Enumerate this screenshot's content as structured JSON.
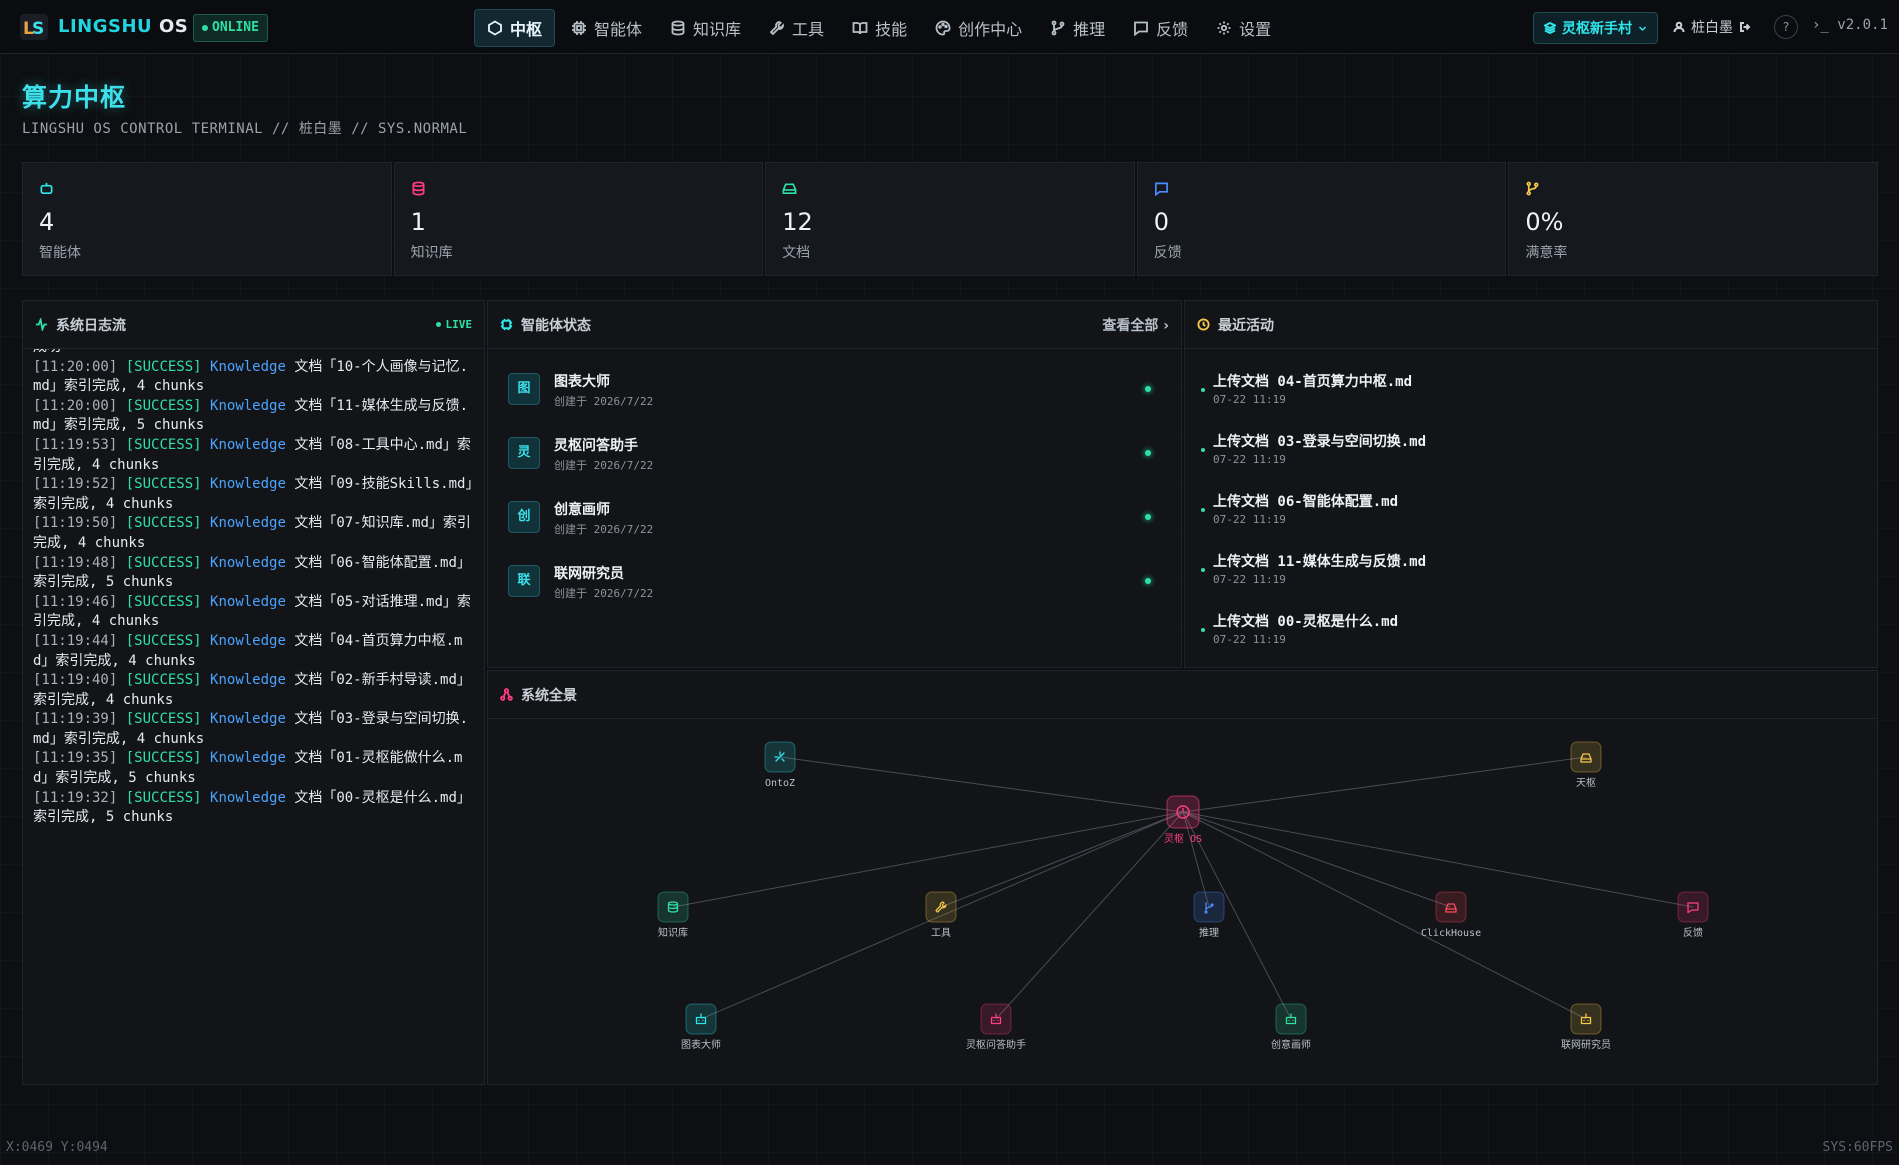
{
  "header": {
    "brand_a": "LINGSHU",
    "brand_b": "OS",
    "status": "ONLINE",
    "nav": [
      {
        "label": "中枢",
        "icon": "hexagon-icon"
      },
      {
        "label": "智能体",
        "icon": "cpu-icon"
      },
      {
        "label": "知识库",
        "icon": "database-icon"
      },
      {
        "label": "工具",
        "icon": "wrench-icon"
      },
      {
        "label": "技能",
        "icon": "book-icon"
      },
      {
        "label": "创作中心",
        "icon": "palette-icon"
      },
      {
        "label": "推理",
        "icon": "branch-icon"
      },
      {
        "label": "反馈",
        "icon": "message-icon"
      },
      {
        "label": "设置",
        "icon": "gear-icon"
      }
    ],
    "space": "灵枢新手村",
    "user": "桩白墨",
    "version": "v2.0.1"
  },
  "page": {
    "title": "算力中枢",
    "subtitle": "LINGSHU OS CONTROL TERMINAL // 桩白墨 // SYS.NORMAL"
  },
  "stats": [
    {
      "value": "4",
      "label": "智能体",
      "icon": "robot-icon",
      "color": "#2ee6ea"
    },
    {
      "value": "1",
      "label": "知识库",
      "icon": "database-icon",
      "color": "#ff3d7f"
    },
    {
      "value": "12",
      "label": "文档",
      "icon": "drive-icon",
      "color": "#2fe0a2"
    },
    {
      "value": "0",
      "label": "反馈",
      "icon": "message-icon",
      "color": "#4a8cff"
    },
    {
      "value": "0%",
      "label": "满意率",
      "icon": "branch-icon",
      "color": "#f5c84a"
    }
  ],
  "log": {
    "title": "系统日志流",
    "live": "LIVE",
    "head_fragment": "成功",
    "lines": [
      {
        "ts": "[11:20:00]",
        "lvl": "[SUCCESS]",
        "mod": "Knowledge",
        "msg": "文档「10-个人画像与记忆.md」索引完成, 4 chunks"
      },
      {
        "ts": "[11:20:00]",
        "lvl": "[SUCCESS]",
        "mod": "Knowledge",
        "msg": "文档「11-媒体生成与反馈.md」索引完成, 5 chunks"
      },
      {
        "ts": "[11:19:53]",
        "lvl": "[SUCCESS]",
        "mod": "Knowledge",
        "msg": "文档「08-工具中心.md」索引完成, 4 chunks"
      },
      {
        "ts": "[11:19:52]",
        "lvl": "[SUCCESS]",
        "mod": "Knowledge",
        "msg": "文档「09-技能Skills.md」索引完成, 4 chunks"
      },
      {
        "ts": "[11:19:50]",
        "lvl": "[SUCCESS]",
        "mod": "Knowledge",
        "msg": "文档「07-知识库.md」索引完成, 4 chunks"
      },
      {
        "ts": "[11:19:48]",
        "lvl": "[SUCCESS]",
        "mod": "Knowledge",
        "msg": "文档「06-智能体配置.md」索引完成, 5 chunks"
      },
      {
        "ts": "[11:19:46]",
        "lvl": "[SUCCESS]",
        "mod": "Knowledge",
        "msg": "文档「05-对话推理.md」索引完成, 4 chunks"
      },
      {
        "ts": "[11:19:44]",
        "lvl": "[SUCCESS]",
        "mod": "Knowledge",
        "msg": "文档「04-首页算力中枢.md」索引完成, 4 chunks"
      },
      {
        "ts": "[11:19:40]",
        "lvl": "[SUCCESS]",
        "mod": "Knowledge",
        "msg": "文档「02-新手村导读.md」索引完成, 4 chunks"
      },
      {
        "ts": "[11:19:39]",
        "lvl": "[SUCCESS]",
        "mod": "Knowledge",
        "msg": "文档「03-登录与空间切换.md」索引完成, 4 chunks"
      },
      {
        "ts": "[11:19:35]",
        "lvl": "[SUCCESS]",
        "mod": "Knowledge",
        "msg": "文档「01-灵枢能做什么.md」索引完成, 5 chunks"
      },
      {
        "ts": "[11:19:32]",
        "lvl": "[SUCCESS]",
        "mod": "Knowledge",
        "msg": "文档「00-灵枢是什么.md」索引完成, 5 chunks"
      }
    ]
  },
  "agents": {
    "title": "智能体状态",
    "view_all": "查看全部 ›",
    "items": [
      {
        "badge": "图",
        "name": "图表大师",
        "meta": "创建于 2026/7/22"
      },
      {
        "badge": "灵",
        "name": "灵枢问答助手",
        "meta": "创建于 2026/7/22"
      },
      {
        "badge": "创",
        "name": "创意画师",
        "meta": "创建于 2026/7/22"
      },
      {
        "badge": "联",
        "name": "联网研究员",
        "meta": "创建于 2026/7/22"
      }
    ]
  },
  "activity": {
    "title": "最近活动",
    "items": [
      {
        "text": "上传文档 04-首页算力中枢.md",
        "time": "07-22 11:19"
      },
      {
        "text": "上传文档 03-登录与空间切换.md",
        "time": "07-22 11:19"
      },
      {
        "text": "上传文档 06-智能体配置.md",
        "time": "07-22 11:19"
      },
      {
        "text": "上传文档 11-媒体生成与反馈.md",
        "time": "07-22 11:19"
      },
      {
        "text": "上传文档 00-灵枢是什么.md",
        "time": "07-22 11:19"
      }
    ]
  },
  "overview": {
    "title": "系统全景",
    "center": {
      "label": "灵枢 OS",
      "color": "#ff3d7f"
    },
    "nodes": [
      {
        "label": "OntoZ",
        "color": "#2ee6ea",
        "icon": "sparkle-icon"
      },
      {
        "label": "天枢",
        "color": "#f5c84a",
        "icon": "drive-icon"
      },
      {
        "label": "知识库",
        "color": "#2fe0a2",
        "icon": "database-icon"
      },
      {
        "label": "工具",
        "color": "#f5c84a",
        "icon": "wrench-icon"
      },
      {
        "label": "推理",
        "color": "#4a8cff",
        "icon": "branch-icon"
      },
      {
        "label": "ClickHouse",
        "color": "#ff4d5e",
        "icon": "drive-icon"
      },
      {
        "label": "反馈",
        "color": "#ff3d7f",
        "icon": "message-icon"
      },
      {
        "label": "图表大师",
        "color": "#2ee6ea",
        "icon": "robot-icon"
      },
      {
        "label": "灵枢问答助手",
        "color": "#ff3d7f",
        "icon": "robot-icon"
      },
      {
        "label": "创意画师",
        "color": "#2fe0a2",
        "icon": "robot-icon"
      },
      {
        "label": "联网研究员",
        "color": "#f5c84a",
        "icon": "robot-icon"
      }
    ]
  },
  "footer": {
    "coords": "X:0469 Y:0494",
    "fps": "SYS:60FPS"
  }
}
